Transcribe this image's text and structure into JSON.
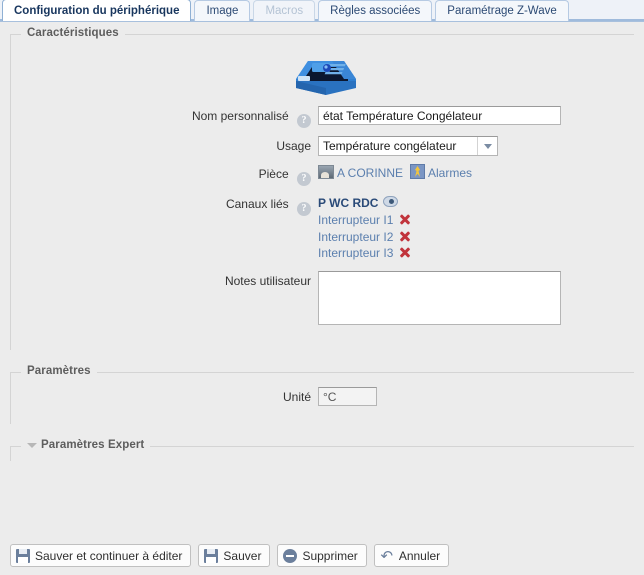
{
  "tabs": [
    {
      "label": "Configuration du périphérique",
      "state": "active"
    },
    {
      "label": "Image",
      "state": "normal"
    },
    {
      "label": "Macros",
      "state": "disabled"
    },
    {
      "label": "Règles associées",
      "state": "normal"
    },
    {
      "label": "Paramétrage Z-Wave",
      "state": "normal"
    }
  ],
  "sections": {
    "caracteristiques": {
      "legend": "Caractéristiques"
    },
    "parametres": {
      "legend": "Paramètres"
    },
    "parametres_expert": {
      "legend": "Paramètres Expert"
    }
  },
  "form": {
    "nom_personnalise": {
      "label": "Nom personnalisé",
      "help": "?",
      "value": "état Température Congélateur",
      "placeholder": ""
    },
    "usage": {
      "label": "Usage",
      "value": "Température congélateur",
      "options": [
        "Température congélateur"
      ]
    },
    "piece": {
      "label": "Pièce",
      "help": "?",
      "room": "A CORINNE",
      "section": "Alarmes"
    },
    "canaux_lies": {
      "label": "Canaux liés",
      "help": "?",
      "items": [
        {
          "name": "P WC RDC",
          "icon": "eye-icon",
          "primary": true
        },
        {
          "name": "Interrupteur I1",
          "icon": "delete-icon",
          "primary": false
        },
        {
          "name": "Interrupteur I2",
          "icon": "delete-icon",
          "primary": false
        },
        {
          "name": "Interrupteur I3",
          "icon": "delete-icon",
          "primary": false
        }
      ]
    },
    "notes": {
      "label": "Notes utilisateur",
      "value": "",
      "placeholder": ""
    },
    "unite": {
      "label": "Unité",
      "value": "°C",
      "placeholder": ""
    }
  },
  "buttons": [
    {
      "label": "Sauver et continuer à éditer",
      "icon": "floppy-disk-icon"
    },
    {
      "label": "Sauver",
      "icon": "floppy-disk-icon"
    },
    {
      "label": "Supprimer",
      "icon": "minus-circle-icon"
    },
    {
      "label": "Annuler",
      "icon": "undo-arrow-icon"
    }
  ],
  "colors": {
    "accent": "#5b7fae",
    "tab_active_text": "#18365e",
    "delete_icon": "#c1343c",
    "page_bg": "#ececec",
    "device_blue": "#2f7fd1"
  }
}
